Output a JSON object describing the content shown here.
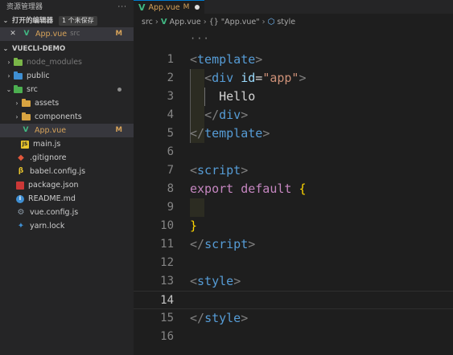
{
  "sidebar": {
    "title": "资源管理器",
    "more": "···",
    "open_editors": {
      "label": "打开的编辑器",
      "unsaved": "1 个未保存",
      "items": [
        {
          "name": "App.vue",
          "path": "src",
          "status": "M"
        }
      ]
    },
    "project": {
      "label": "VUECLI-DEMO",
      "tree": {
        "node_modules": "node_modules",
        "public": "public",
        "src": "src",
        "assets": "assets",
        "components": "components",
        "app_vue": "App.vue",
        "app_vue_status": "M",
        "main_js": "main.js",
        "gitignore": ".gitignore",
        "babel": "babel.config.js",
        "package": "package.json",
        "readme": "README.md",
        "vueconfig": "vue.config.js",
        "yarnlock": "yarn.lock"
      }
    }
  },
  "editor": {
    "tab": {
      "label": "App.vue",
      "status": "M"
    },
    "breadcrumb": {
      "src": "src",
      "file": "App.vue",
      "component": "{} \"App.vue\"",
      "symbol": "style"
    },
    "ellipsis": "···",
    "line_numbers": [
      "1",
      "2",
      "3",
      "4",
      "5",
      "6",
      "7",
      "8",
      "9",
      "10",
      "11",
      "12",
      "13",
      "14",
      "15",
      "16"
    ],
    "current_line": 14
  },
  "colors": {
    "vue": "#41b883",
    "modified": "#d7a35a",
    "tag": "#569cd6",
    "attr": "#9cdcfe",
    "string": "#ce9178",
    "keyword": "#c586c0"
  }
}
